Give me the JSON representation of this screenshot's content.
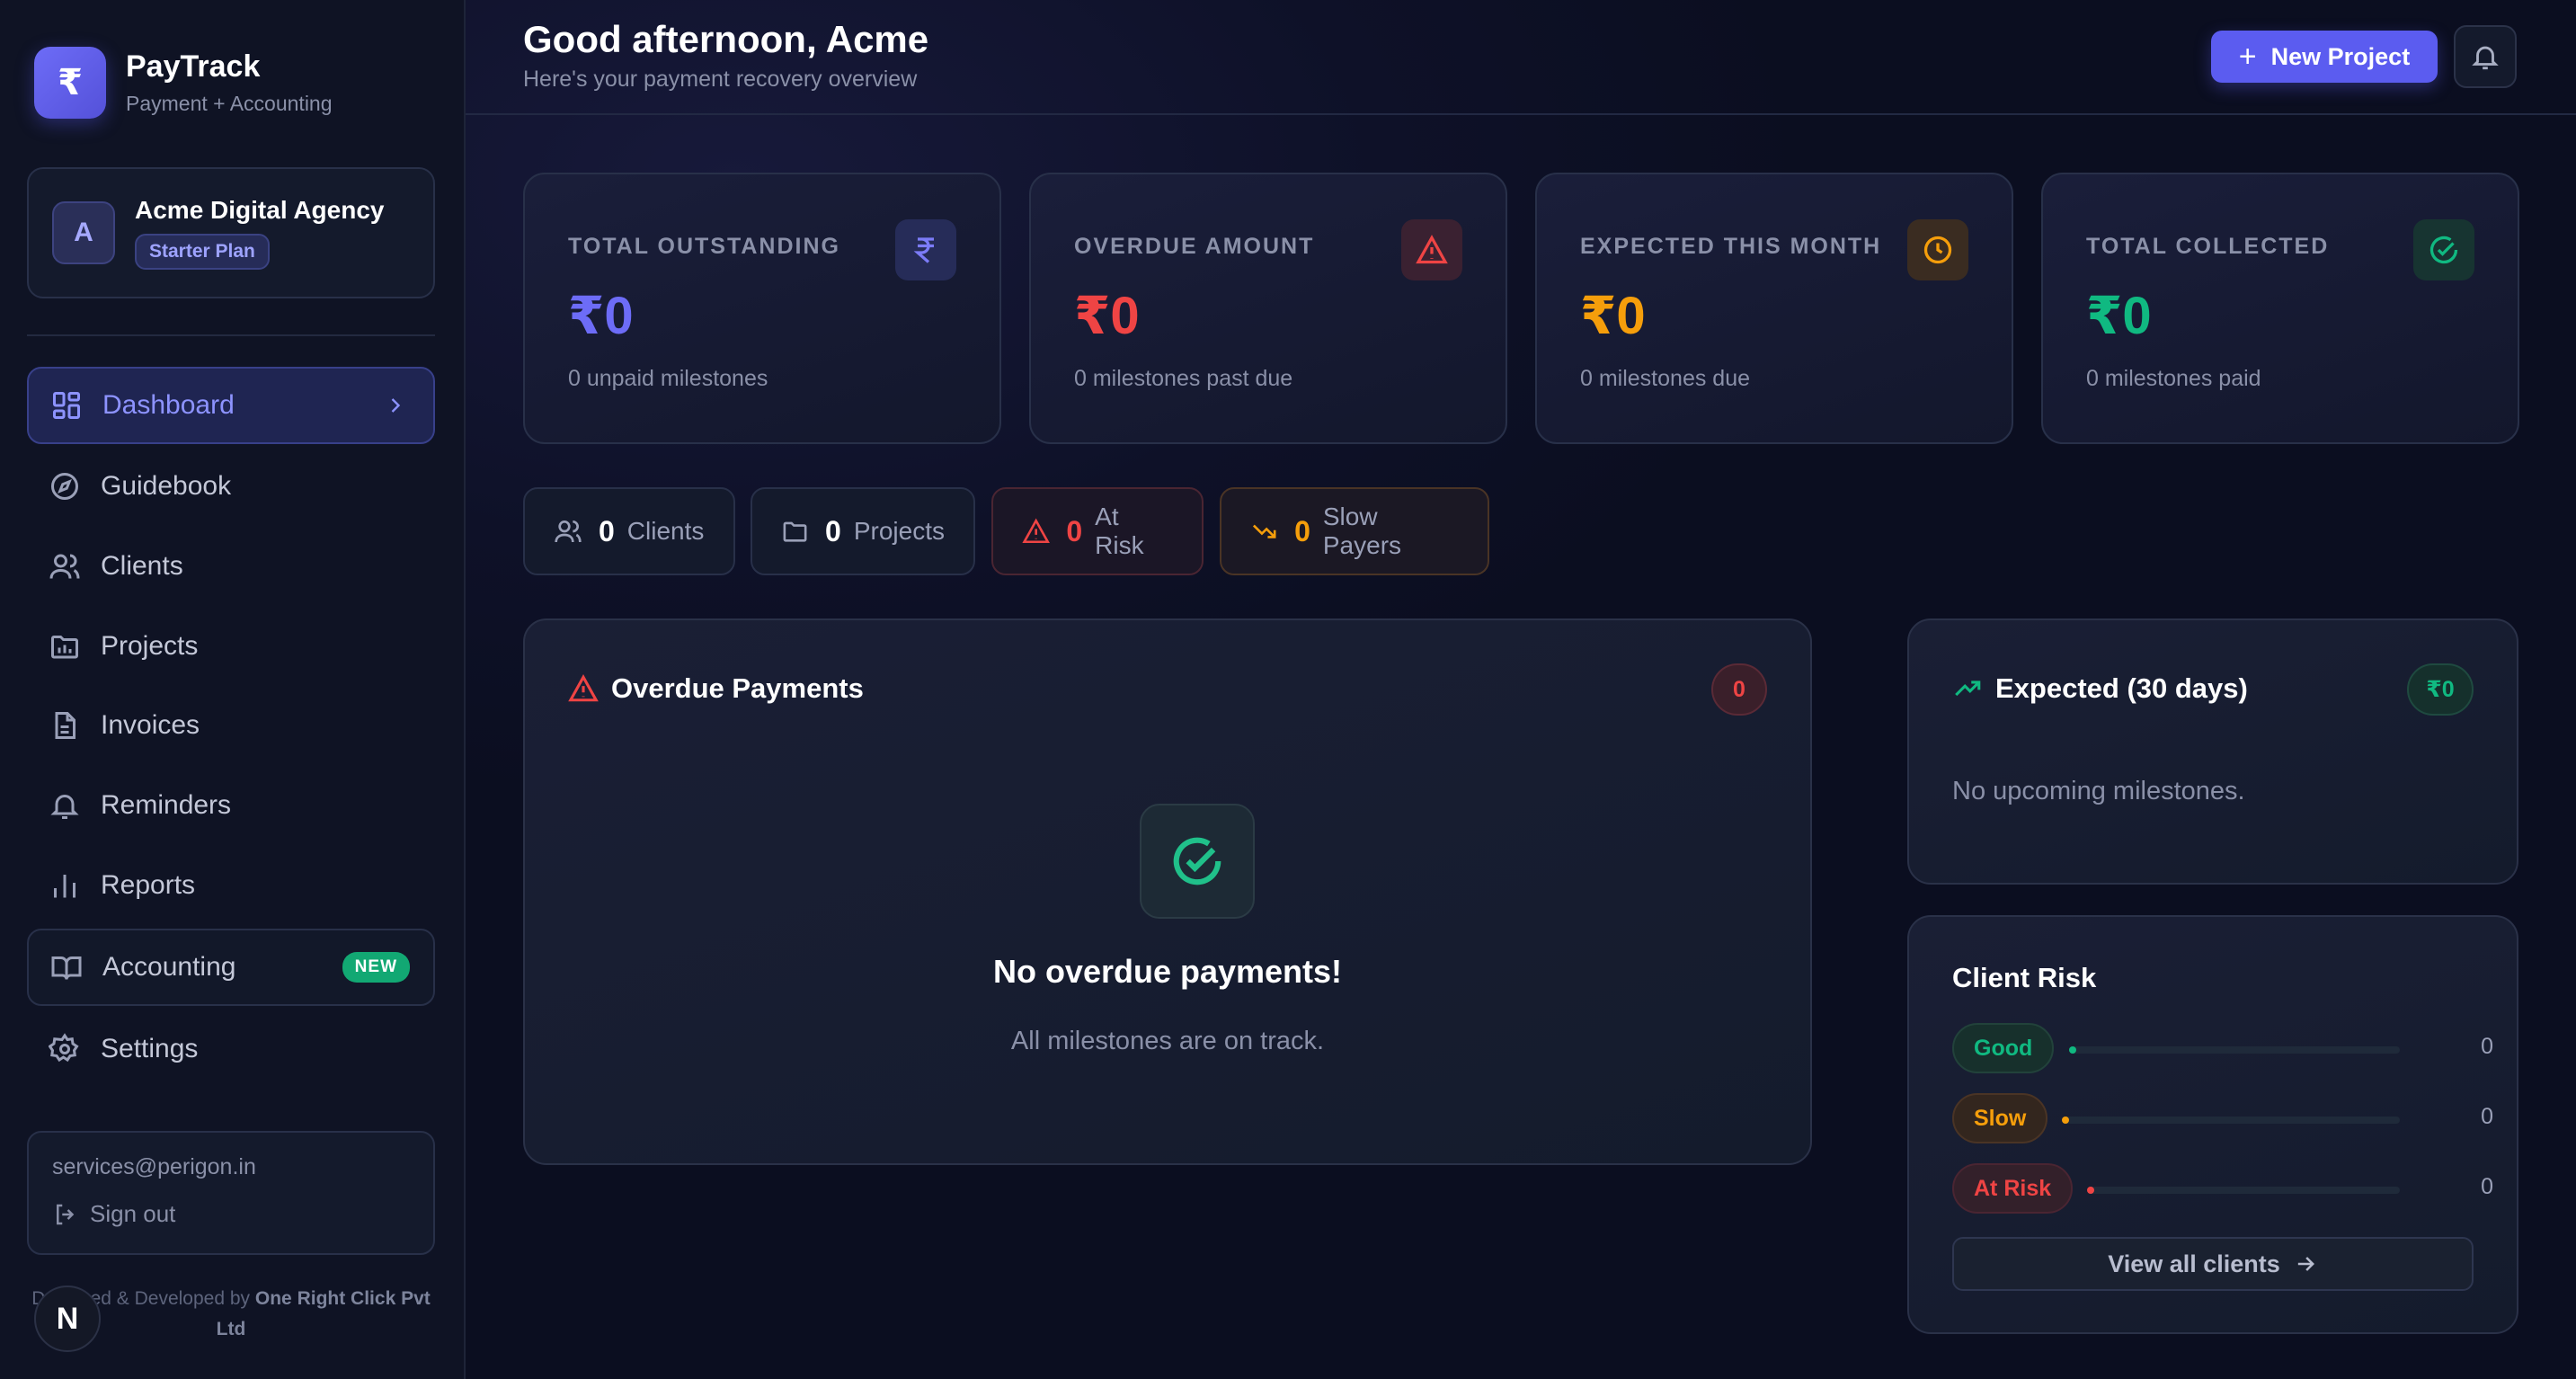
{
  "brand": {
    "name": "PayTrack",
    "subtitle": "Payment + Accounting",
    "logo_glyph": "₹"
  },
  "org": {
    "avatar_letter": "A",
    "name": "Acme Digital Agency",
    "plan": "Starter Plan"
  },
  "nav": [
    {
      "label": "Dashboard",
      "icon": "dashboard-icon",
      "active": true
    },
    {
      "label": "Guidebook",
      "icon": "compass-icon"
    },
    {
      "label": "Clients",
      "icon": "users-icon"
    },
    {
      "label": "Projects",
      "icon": "folder-icon"
    },
    {
      "label": "Invoices",
      "icon": "document-icon"
    },
    {
      "label": "Reminders",
      "icon": "bell-icon"
    },
    {
      "label": "Reports",
      "icon": "bar-chart-icon"
    },
    {
      "label": "Accounting",
      "icon": "book-icon",
      "badge": "NEW"
    },
    {
      "label": "Settings",
      "icon": "gear-icon"
    }
  ],
  "account": {
    "email": "services@perigon.in",
    "signout_label": "Sign out"
  },
  "credits": {
    "prefix": "Designed & Developed by",
    "company": "One Right Click Pvt Ltd",
    "badge_letter": "N"
  },
  "header": {
    "greeting": "Good afternoon, Acme",
    "subtitle": "Here's your payment recovery overview",
    "new_project_label": "New Project"
  },
  "stats": [
    {
      "label": "TOTAL OUTSTANDING",
      "value": "₹0",
      "sub": "0 unpaid milestones",
      "color": "#6d6cf7",
      "icon": "rupee-icon"
    },
    {
      "label": "OVERDUE AMOUNT",
      "value": "₹0",
      "sub": "0 milestones past due",
      "color": "#ef4444",
      "icon": "warning-icon"
    },
    {
      "label": "EXPECTED THIS MONTH",
      "value": "₹0",
      "sub": "0 milestones due",
      "color": "#f59e0b",
      "icon": "clock-icon"
    },
    {
      "label": "TOTAL COLLECTED",
      "value": "₹0",
      "sub": "0 milestones paid",
      "color": "#10b981",
      "icon": "check-circle-icon"
    }
  ],
  "pills": [
    {
      "count": "0",
      "label": "Clients",
      "icon": "users-icon"
    },
    {
      "count": "0",
      "label": "Projects",
      "icon": "folder-icon"
    },
    {
      "count": "0",
      "label": "At Risk",
      "icon": "warning-icon",
      "color": "#ef4444"
    },
    {
      "count": "0",
      "label": "Slow Payers",
      "icon": "trending-down-icon",
      "color": "#f59e0b"
    }
  ],
  "overdue": {
    "title": "Overdue Payments",
    "count": "0",
    "empty_title": "No overdue payments!",
    "empty_sub": "All milestones are on track."
  },
  "expected": {
    "title": "Expected (30 days)",
    "badge": "₹0",
    "empty": "No upcoming milestones."
  },
  "risk": {
    "title": "Client Risk",
    "rows": [
      {
        "label": "Good",
        "count": "0",
        "color": "#10b981"
      },
      {
        "label": "Slow",
        "count": "0",
        "color": "#f59e0b"
      },
      {
        "label": "At Risk",
        "count": "0",
        "color": "#ef4444"
      }
    ],
    "view_all_label": "View all clients"
  }
}
